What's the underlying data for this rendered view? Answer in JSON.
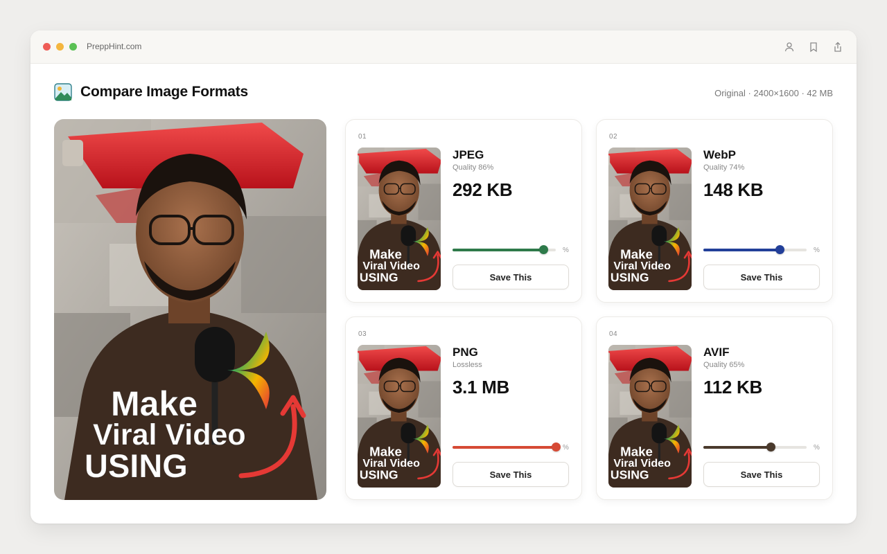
{
  "browser": {
    "url": "PreppHint.com",
    "icons": [
      "user-icon",
      "bookmark-icon",
      "share-icon"
    ]
  },
  "header": {
    "title": "Compare Image Formats",
    "meta": "Original · 2400×1600 · 42 MB",
    "logo_icon": "image-icon"
  },
  "hero": {
    "overlay_line1": "Make",
    "overlay_line2": "Viral Video",
    "overlay_line3": "USING"
  },
  "cards": [
    {
      "index": "01",
      "format": "JPEG",
      "quality": "Quality 86%",
      "size": "292 KB",
      "slider_value": 0.88,
      "color": "#2e7a4a",
      "pct_label": "%",
      "button": "Save This"
    },
    {
      "index": "02",
      "format": "WebP",
      "quality": "Quality 74%",
      "size": "148 KB",
      "slider_value": 0.74,
      "color": "#223f99",
      "pct_label": "%",
      "button": "Save This"
    },
    {
      "index": "03",
      "format": "PNG",
      "quality": "Lossless",
      "size": "3.1 MB",
      "slider_value": 1.0,
      "color": "#d64a35",
      "pct_label": "%",
      "button": "Save This"
    },
    {
      "index": "04",
      "format": "AVIF",
      "quality": "Quality 65%",
      "size": "112 KB",
      "slider_value": 0.65,
      "color": "#4a3a2c",
      "pct_label": "%",
      "button": "Save This"
    }
  ]
}
